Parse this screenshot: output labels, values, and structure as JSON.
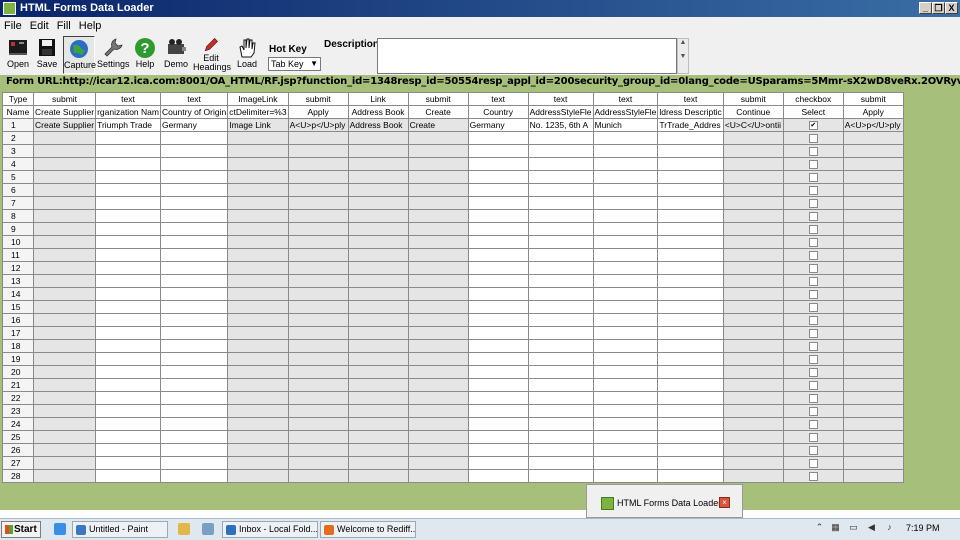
{
  "window": {
    "title": "HTML Forms Data Loader",
    "min": "_",
    "restore": "❐",
    "close": "X"
  },
  "menu": [
    "File",
    "Edit",
    "Fill",
    "Help"
  ],
  "toolbar": {
    "buttons": [
      {
        "label": "Open",
        "icon": "folder-icon"
      },
      {
        "label": "Save",
        "icon": "floppy-icon"
      },
      {
        "label": "Capture",
        "icon": "globe-icon"
      },
      {
        "label": "Settings",
        "icon": "wrench-icon"
      },
      {
        "label": "Help",
        "icon": "help-icon"
      },
      {
        "label": "Demo",
        "icon": "projector-icon"
      },
      {
        "label": "Edit Headings",
        "icon": "pencil-icon"
      },
      {
        "label": "Load",
        "icon": "hand-icon"
      }
    ],
    "hotkey_label": "Hot Key",
    "hotkey_value": "Tab Key",
    "description_label": "Description",
    "description_value": ""
  },
  "form_url": "Form URL:http://icar12.ica.com:8001/OA_HTML/RF.jsp?function_id=1348resp_id=50554resp_appl_id=200security_group_id=0lang_code=USparams=5Mmr-sX2wD8veRx.2OVRyv3rMg8JhpTHtFoTndKnFFI",
  "grid": {
    "type_label": "Type",
    "name_label": "Name",
    "columns": [
      {
        "type": "submit",
        "name": "Create Supplier"
      },
      {
        "type": "text",
        "name": "rganization Nam"
      },
      {
        "type": "text",
        "name": "Country of Origin"
      },
      {
        "type": "ImageLink",
        "name": "ctDelimiter=%3"
      },
      {
        "type": "submit",
        "name": "Apply"
      },
      {
        "type": "Link",
        "name": "Address Book"
      },
      {
        "type": "submit",
        "name": "Create"
      },
      {
        "type": "text",
        "name": "Country"
      },
      {
        "type": "text",
        "name": "AddressStyleFle"
      },
      {
        "type": "text",
        "name": "AddressStyleFle"
      },
      {
        "type": "text",
        "name": "ldress Descriptic"
      },
      {
        "type": "submit",
        "name": "Continue"
      },
      {
        "type": "checkbox",
        "name": "Select"
      },
      {
        "type": "submit",
        "name": "Apply"
      }
    ],
    "row1": [
      "Create Supplier",
      "Triumph Trade",
      "Germany",
      "Image Link",
      "A<U>p</U>ply",
      "Address Book",
      "Create",
      "Germany",
      "No. 1235, 6th A",
      "Munich",
      "TrTrade_Addres",
      "<U>C</U>ontii",
      "✔",
      "A<U>p</U>ply"
    ],
    "row_numbers": [
      "1",
      "2",
      "3",
      "4",
      "5",
      "6",
      "7",
      "8",
      "9",
      "10",
      "11",
      "12",
      "13",
      "14",
      "15",
      "16",
      "17",
      "18",
      "19",
      "20",
      "21",
      "22",
      "23",
      "24",
      "25",
      "26",
      "27",
      "28"
    ]
  },
  "popup": {
    "title": "HTML Forms Data Loader"
  },
  "taskbar": {
    "start": "Start",
    "tasks": [
      {
        "label": "Untitled - Paint",
        "color": "#3b78c4"
      },
      {
        "label": "Inbox - Local Fold...",
        "color": "#2f6fbf"
      },
      {
        "label": "Welcome to Rediff...",
        "color": "#e36c1e"
      }
    ],
    "time": "7:19 PM"
  }
}
